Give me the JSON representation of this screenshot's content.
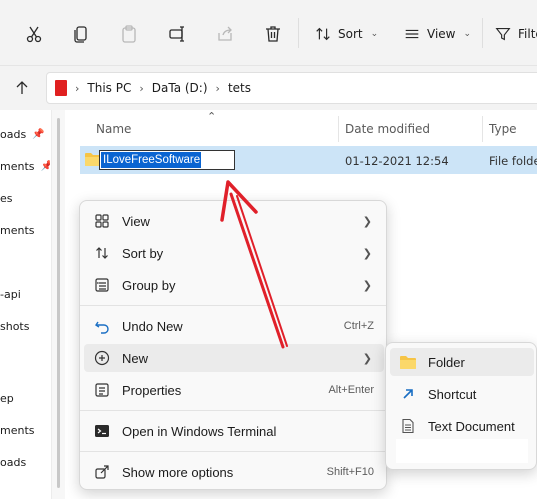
{
  "toolbar": {
    "sort_label": "Sort",
    "view_label": "View",
    "filter_label": "Filte"
  },
  "breadcrumb": {
    "items": [
      "This PC",
      "DaTa (D:)",
      "tets"
    ]
  },
  "nav": {
    "items": [
      {
        "label": "oads",
        "pinned": true
      },
      {
        "label": "ments",
        "pinned": true
      },
      {
        "label": "es",
        "pinned": false
      },
      {
        "label": "ments",
        "pinned": false
      },
      {
        "label": "-api",
        "pinned": false
      },
      {
        "label": "shots",
        "pinned": false
      },
      {
        "label": "ep",
        "pinned": false
      },
      {
        "label": "ments",
        "pinned": false
      },
      {
        "label": "oads",
        "pinned": false
      }
    ]
  },
  "columns": {
    "name": "Name",
    "date_modified": "Date modified",
    "type": "Type"
  },
  "file": {
    "rename_value": "ILoveFreeSoftware",
    "date": "01-12-2021 12:54",
    "type": "File folde"
  },
  "context_menu": {
    "items": [
      {
        "label": "View",
        "shortcut": "",
        "submenu": true,
        "icon": "view-grid-icon"
      },
      {
        "label": "Sort by",
        "shortcut": "",
        "submenu": true,
        "icon": "sort-icon"
      },
      {
        "label": "Group by",
        "shortcut": "",
        "submenu": true,
        "icon": "group-icon"
      },
      {
        "label": "Undo New",
        "shortcut": "Ctrl+Z",
        "submenu": false,
        "icon": "undo-icon"
      },
      {
        "label": "New",
        "shortcut": "",
        "submenu": true,
        "icon": "plus-circle-icon"
      },
      {
        "label": "Properties",
        "shortcut": "Alt+Enter",
        "submenu": false,
        "icon": "properties-icon"
      },
      {
        "label": "Open in Windows Terminal",
        "shortcut": "",
        "submenu": false,
        "icon": "terminal-icon"
      },
      {
        "label": "Show more options",
        "shortcut": "Shift+F10",
        "submenu": false,
        "icon": "share-options-icon"
      }
    ]
  },
  "new_submenu": {
    "items": [
      {
        "label": "Folder",
        "icon": "folder-icon"
      },
      {
        "label": "Shortcut",
        "icon": "shortcut-icon"
      },
      {
        "label": "Text Document",
        "icon": "text-document-icon"
      }
    ]
  },
  "colors": {
    "selection": "#cce4f7",
    "rename_highlight": "#0a64d1",
    "annotation_arrow": "#e0202a",
    "drive_icon": "#e02020",
    "folder": "#f6c445"
  }
}
